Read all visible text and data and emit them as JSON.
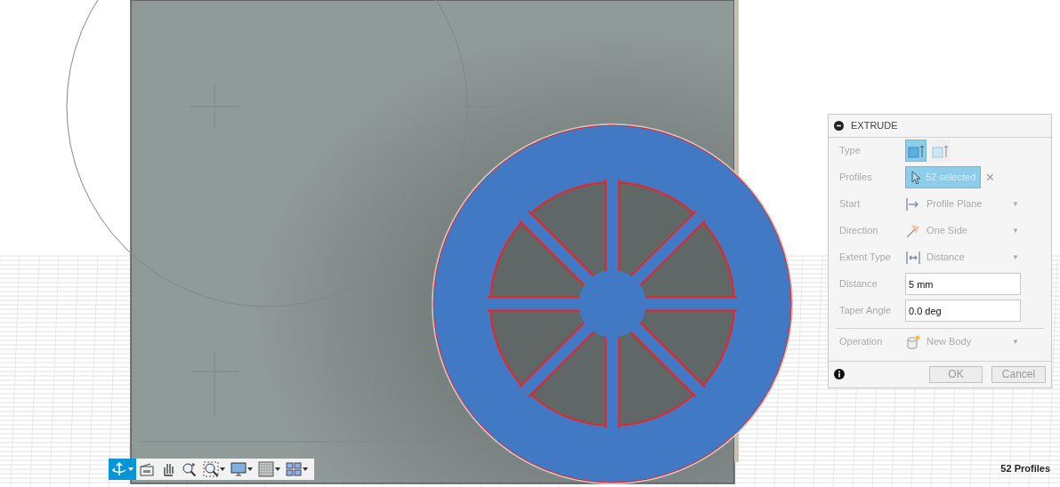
{
  "panel": {
    "title": "EXTRUDE",
    "rows": [
      {
        "kind": "toggle",
        "label": "Type",
        "options": [
          {
            "selected": true
          },
          {
            "selected": false
          }
        ]
      },
      {
        "kind": "selection",
        "label": "Profiles",
        "value": "52 selected",
        "clear": "×"
      },
      {
        "kind": "dropdown",
        "label": "Start",
        "value": "Profile Plane",
        "caret": "▼"
      },
      {
        "kind": "dropdown",
        "label": "Direction",
        "value": "One Side",
        "caret": "▼"
      },
      {
        "kind": "dropdown",
        "label": "Extent Type",
        "value": "Distance",
        "caret": "▼"
      },
      {
        "kind": "input",
        "label": "Distance",
        "value": "5 mm"
      },
      {
        "kind": "input",
        "label": "Taper Angle",
        "value": "0.0 deg"
      },
      {
        "kind": "divider"
      },
      {
        "kind": "dropdown",
        "label": "Operation",
        "value": "New Body",
        "caret": "▼"
      }
    ],
    "buttons": [
      {
        "label": "OK",
        "disabled": true
      },
      {
        "label": "Cancel",
        "disabled": true
      }
    ]
  },
  "toolbar": [
    {
      "dropdown": true,
      "selected": true
    },
    {
      "dropdown": false,
      "selected": false
    },
    {
      "dropdown": false,
      "selected": false
    },
    {
      "dropdown": false,
      "selected": false
    },
    {
      "dropdown": true,
      "selected": false
    },
    {
      "dropdown": true,
      "selected": false
    },
    {
      "dropdown": true,
      "selected": false
    },
    {
      "dropdown": true,
      "selected": false
    }
  ],
  "status": "52 Profiles"
}
